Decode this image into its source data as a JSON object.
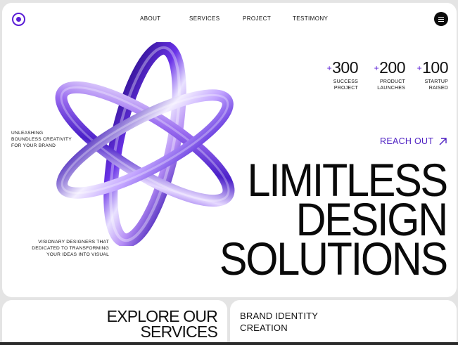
{
  "nav": {
    "items": [
      "ABOUT",
      "SERVICES",
      "PROJECT",
      "TESTIMONY"
    ],
    "logo_icon": "target-circle-icon",
    "menu_icon": "hamburger-menu-icon"
  },
  "stats": [
    {
      "plus": "+",
      "value": "300",
      "label_line1": "SUCCESS",
      "label_line2": "PROJECT"
    },
    {
      "plus": "+",
      "value": "200",
      "label_line1": "PRODUCT",
      "label_line2": "LAUNCHES"
    },
    {
      "plus": "+",
      "value": "100",
      "label_line1": "STARTUP",
      "label_line2": "RAISED"
    }
  ],
  "tagline_left": {
    "line1": "UNLEASHING",
    "line2": "BOUNDLESS CREATIVITY",
    "line3": "FOR YOUR BRAND"
  },
  "tagline_bottom": {
    "line1": "VISIONARY DESIGNERS THAT",
    "line2": "DEDICATED TO TRANSFORMING",
    "line3": "YOUR IDEAS INTO VISUAL"
  },
  "cta": {
    "label": "REACH OUT",
    "icon": "arrow-up-right-icon"
  },
  "headline": {
    "line1": "LIMITLESS",
    "line2": "DESIGN",
    "line3": "SOLUTIONS"
  },
  "cards": {
    "explore_line1": "EXPLORE OUR",
    "explore_line2": "SERVICES",
    "brand_line1": "BRAND IDENTITY",
    "brand_line2": "CREATION"
  },
  "colors": {
    "accent": "#5b1fd6",
    "text": "#111111",
    "background": "#e4e4e4",
    "panel": "#ffffff"
  }
}
